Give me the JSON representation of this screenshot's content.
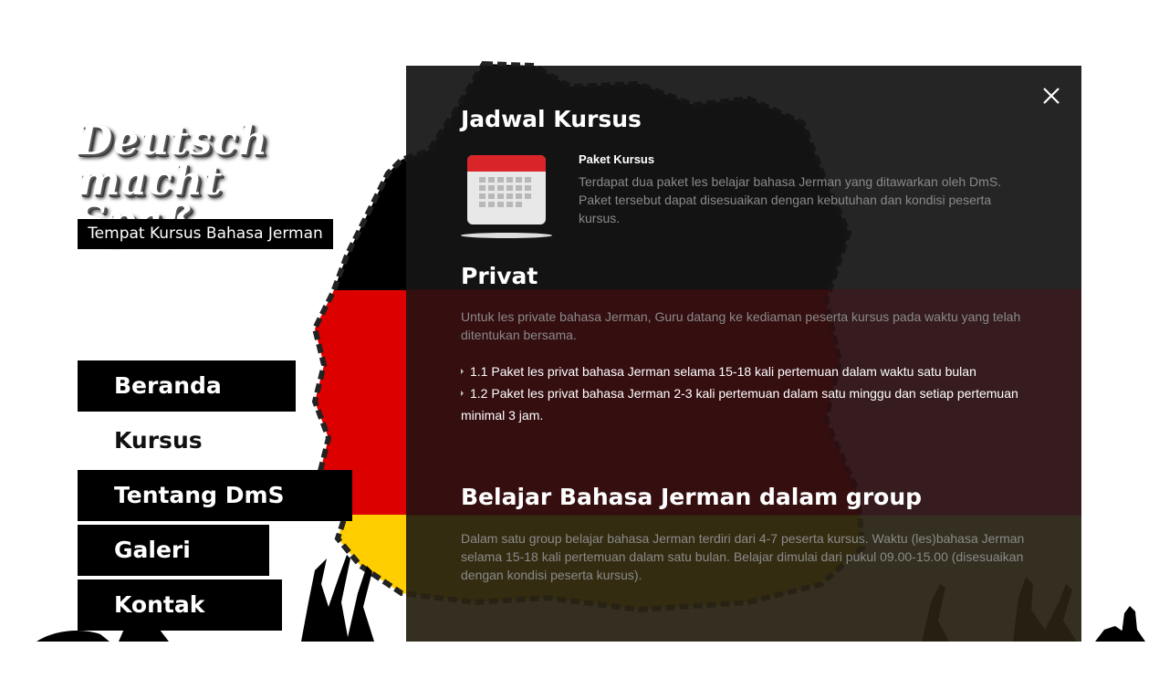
{
  "brand": {
    "logo_line1": "Deutsch",
    "logo_line2": "macht Spaß",
    "tagline": "Tempat Kursus Bahasa Jerman"
  },
  "nav": {
    "items": [
      {
        "label": "Beranda",
        "active": false
      },
      {
        "label": "Kursus",
        "active": true
      },
      {
        "label": "Tentang DmS",
        "active": false
      },
      {
        "label": "Galeri",
        "active": false
      },
      {
        "label": "Kontak",
        "active": false
      }
    ]
  },
  "modal": {
    "close_icon": "close-icon",
    "title": "Jadwal Kursus",
    "package": {
      "icon": "calendar-icon",
      "heading": "Paket Kursus",
      "text": "Terdapat dua paket les belajar bahasa Jerman yang ditawarkan oleh DmS. Paket tersebut dapat disesuaikan dengan kebutuhan dan kondisi peserta kursus."
    },
    "privat": {
      "title": "Privat",
      "text": "Untuk les private bahasa Jerman, Guru datang ke kediaman peserta kursus pada waktu yang telah ditentukan bersama.",
      "items": [
        "1.1 Paket les privat bahasa Jerman selama 15-18 kali pertemuan dalam waktu satu bulan",
        "1.2 Paket les privat bahasa Jerman 2-3 kali pertemuan dalam satu minggu dan setiap pertemuan minimal 3 jam."
      ]
    },
    "group": {
      "title": "Belajar Bahasa Jerman dalam group",
      "text": "Dalam satu group belajar bahasa Jerman terdiri dari 4-7 peserta kursus. Waktu (les)bahasa Jerman selama 15-18 kali pertemuan dalam satu bulan. Belajar dimulai dari pukul 09.00-15.00 (disesuaikan dengan kondisi peserta kursus)."
    }
  },
  "colors": {
    "flag_black": "#000000",
    "flag_red": "#dd0000",
    "flag_gold": "#ffce00",
    "panel_bg": "#141414",
    "muted_text": "#8a8a8a"
  }
}
